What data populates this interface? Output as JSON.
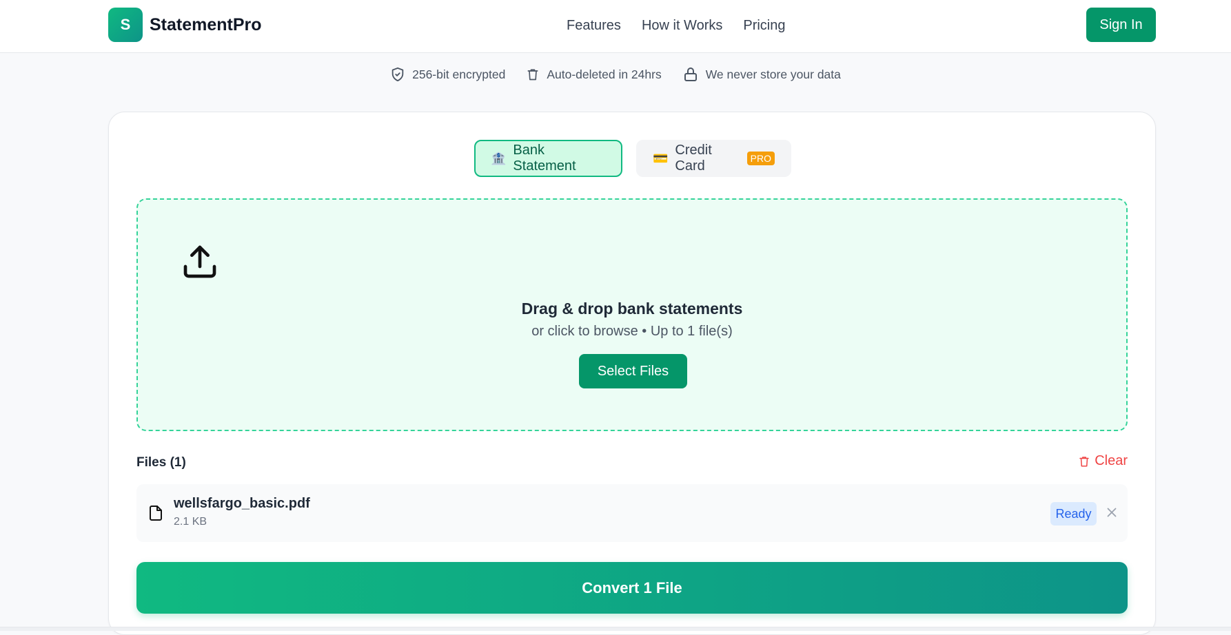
{
  "header": {
    "logo_letter": "S",
    "brand": "StatementPro",
    "nav": [
      "Features",
      "How it Works",
      "Pricing"
    ],
    "signin_label": "Sign In"
  },
  "trust": {
    "items": [
      {
        "icon": "shield-icon",
        "label": "256-bit encrypted"
      },
      {
        "icon": "trash-icon",
        "label": "Auto-deleted in 24hrs"
      },
      {
        "icon": "lock-icon",
        "label": "We never store your data"
      }
    ]
  },
  "tabs": {
    "bank": {
      "emoji": "🏦",
      "label": "Bank Statement"
    },
    "card": {
      "emoji": "💳",
      "label": "Credit Card",
      "badge": "PRO"
    }
  },
  "dropzone": {
    "title": "Drag & drop bank statements",
    "subtitle": "or click to browse • Up to 1 file(s)",
    "select_label": "Select Files"
  },
  "files": {
    "heading": "Files (1)",
    "clear_label": "Clear",
    "items": [
      {
        "name": "wellsfargo_basic.pdf",
        "size": "2.1 KB",
        "status": "Ready"
      }
    ]
  },
  "convert_label": "Convert 1 File",
  "colors": {
    "brand": "#059669",
    "accent_gradient_start": "#10b981",
    "accent_gradient_end": "#0d9488",
    "danger": "#ef4444",
    "status_ready_bg": "#dbeafe",
    "status_ready_text": "#2563eb",
    "pro_badge": "#f59e0b"
  }
}
